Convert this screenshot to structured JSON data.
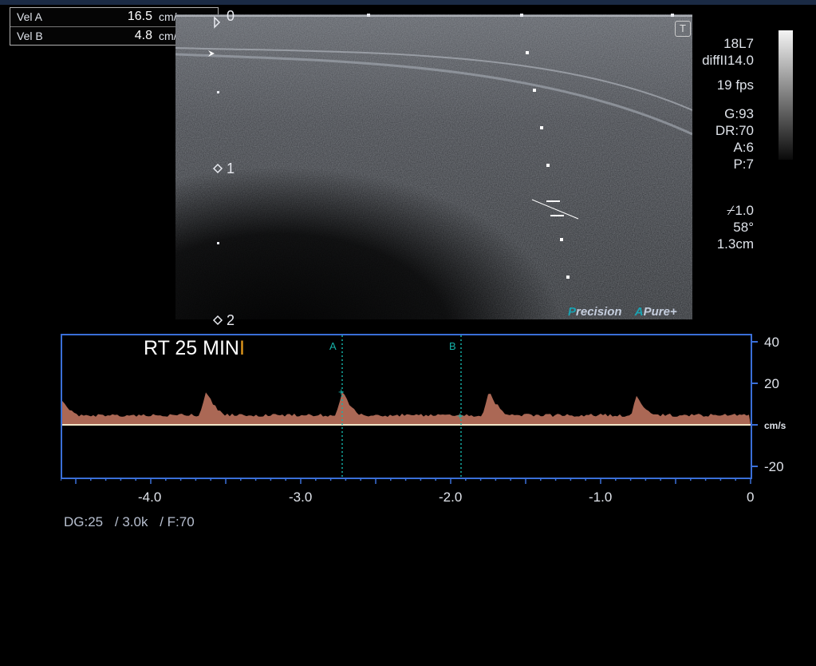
{
  "measurements": [
    {
      "label": "Vel  A",
      "value": "16.5",
      "unit": "cm/s"
    },
    {
      "label": "Vel  B",
      "value": "4.8",
      "unit": "cm/s"
    }
  ],
  "depth_markers": [
    "0",
    "1",
    "2"
  ],
  "probe_params": {
    "probe": "18L7",
    "mode": "diffII14.0",
    "fps": "19 fps",
    "gain": "G:93",
    "dynamic_range": "DR:70",
    "a": "A:6",
    "p": "P:7",
    "steer": "1.0",
    "angle": "58°",
    "gate": "1.3cm"
  },
  "brand": {
    "precision_initial": "P",
    "precision_rest": "recision",
    "pure_initial": "A",
    "pure_rest": "Pure+"
  },
  "doppler": {
    "title": "RT 25 MIN",
    "cursor_glyph": "I",
    "unit": "cm/s",
    "y_ticks": [
      "40",
      "20",
      "-20"
    ],
    "x_ticks": [
      "-4.0",
      "-3.0",
      "-2.0",
      "-1.0",
      "0"
    ],
    "marker_a": "A",
    "marker_b": "B"
  },
  "footer": {
    "dg": "DG:25",
    "prf": "/ 3.0k",
    "filter": "/ F:70"
  },
  "colors": {
    "doppler_border": "#3a6fd8",
    "marker": "#16b2a9",
    "spectrum": "#c97a64",
    "baseline": "#f2e6c8"
  },
  "icons": {
    "t_icon": "T",
    "chevron": "arrow-right-icon",
    "steer_icon": "steer-icon"
  }
}
